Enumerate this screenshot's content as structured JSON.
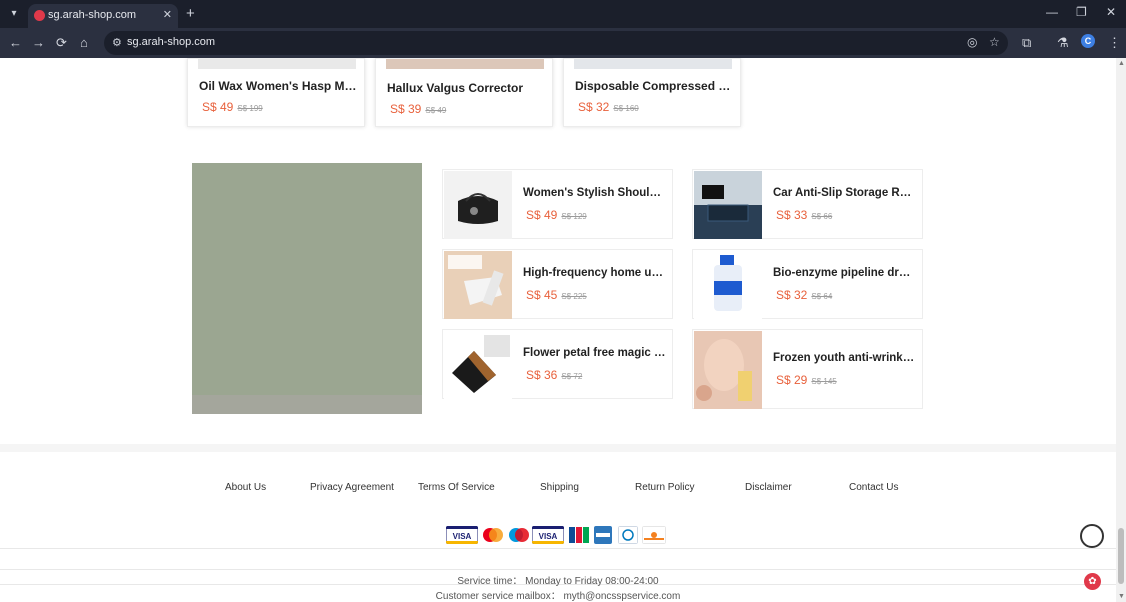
{
  "browser": {
    "tab_title": "sg.arah-shop.com",
    "url": "sg.arah-shop.com",
    "profile_initial": "C"
  },
  "top_products": [
    {
      "title": "Oil Wax Women's Hasp Money ...",
      "price": "S$ 49",
      "old_price": "S$ 199"
    },
    {
      "title": "Hallux Valgus Corrector",
      "price": "S$ 39",
      "old_price": "S$ 49"
    },
    {
      "title": "Disposable Compressed Cotto...",
      "price": "S$ 32",
      "old_price": "S$ 160"
    }
  ],
  "grid_products": [
    {
      "title": "Women's Stylish Shoulder B...",
      "price": "S$ 49",
      "old_price": "S$ 129",
      "image": "bag-icon"
    },
    {
      "title": "Car Anti-Slip Storage Rack",
      "price": "S$ 33",
      "old_price": "S$ 66",
      "image": "car-mat-icon"
    },
    {
      "title": "High-frequency home use ...",
      "price": "S$ 45",
      "old_price": "S$ 225",
      "image": "vacuum-icon"
    },
    {
      "title": "Bio-enzyme pipeline dredgi...",
      "price": "S$ 32",
      "old_price": "S$ 64",
      "image": "bottle-icon"
    },
    {
      "title": "Flower petal free magic ma...",
      "price": "S$ 36",
      "old_price": "S$ 72",
      "image": "makeup-pad-icon"
    },
    {
      "title": "Frozen youth anti-wrinkle e...",
      "price": "S$ 29",
      "old_price": "S$ 145",
      "image": "face-serum-icon"
    }
  ],
  "footer": {
    "links": [
      "About Us",
      "Privacy Agreement",
      "Terms Of Service",
      "Shipping",
      "Return Policy",
      "Disclaimer",
      "Contact Us"
    ],
    "service_time": "Service time：  Monday to Friday 08:00-24:00",
    "service_mail": "Customer service mailbox：  myth@oncsspservice.com"
  },
  "colors": {
    "price": "#e8613c",
    "chrome_bg": "#1b1f2b",
    "banner": "#9ba691"
  }
}
